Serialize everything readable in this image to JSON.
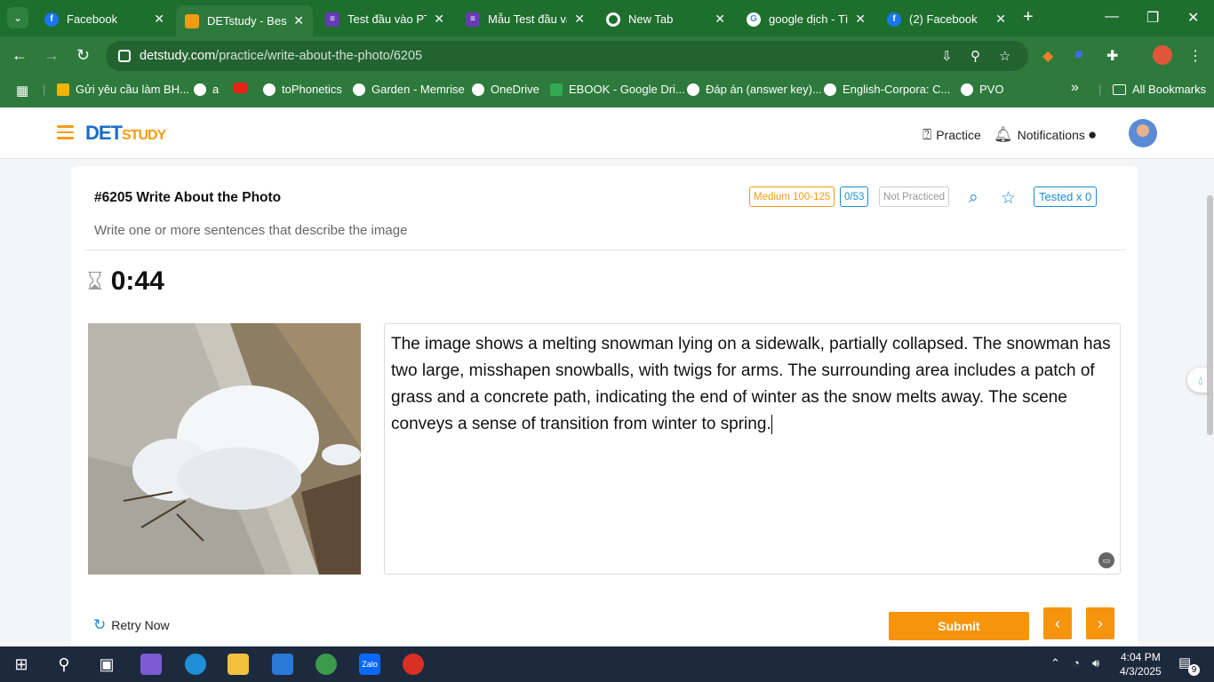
{
  "browser": {
    "tabs": [
      {
        "title": "Facebook",
        "favicon": "facebook-icon",
        "color": "#1877f2"
      },
      {
        "title": "DETstudy - Best",
        "favicon": "detstudy-icon",
        "color": "#f39c12"
      },
      {
        "title": "Test đầu vào PTE",
        "favicon": "forms-icon",
        "color": "#673ab7"
      },
      {
        "title": "Mẫu Test đầu vào",
        "favicon": "forms-icon",
        "color": "#673ab7"
      },
      {
        "title": "New Tab",
        "favicon": "chrome-icon",
        "color": "#ffffff"
      },
      {
        "title": "google dịch - Tìm",
        "favicon": "google-icon",
        "color": "#ffffff"
      },
      {
        "title": "(2) Facebook",
        "favicon": "facebook-icon",
        "color": "#1877f2"
      }
    ],
    "url_host": "detstudy.com",
    "url_path": "/practice/write-about-the-photo/6205",
    "bookmarks": [
      {
        "label": "Gửi yêu cầu làm BH..."
      },
      {
        "label": "a"
      },
      {
        "label": ""
      },
      {
        "label": "toPhonetics"
      },
      {
        "label": "Garden - Memrise"
      },
      {
        "label": "OneDrive"
      },
      {
        "label": "EBOOK - Google Dri..."
      },
      {
        "label": "Đáp án (answer key)..."
      },
      {
        "label": "English-Corpora: C..."
      },
      {
        "label": "PVO"
      }
    ],
    "bookmarks_more": "»",
    "all_bookmarks": "All Bookmarks"
  },
  "header": {
    "logo_main": "DET",
    "logo_sub": "STUDY",
    "practice": "Practice",
    "notifications": "Notifications"
  },
  "question": {
    "title": "#6205 Write About the Photo",
    "level": "Medium 100-125",
    "progress": "0/53",
    "status": "Not Practiced",
    "tested": "Tested x 0",
    "instruction": "Write one or more sentences that describe the image"
  },
  "timer": "0:44",
  "answer_text": " The image shows a melting snowman lying on a sidewalk, partially collapsed. The snowman has two large, misshapen snowballs, with twigs for arms. The surrounding area includes a patch of grass and a concrete path, indicating the end of winter as the snow melts away. The scene conveys a sense of transition from winter to spring.",
  "actions": {
    "retry": "Retry Now",
    "submit": "Submit",
    "prev": "‹",
    "next": "›"
  },
  "taskbar": {
    "time": "4:04 PM",
    "date": "4/3/2025",
    "notif_count": "9"
  },
  "colors": {
    "brand_orange": "#f7940e",
    "brand_blue": "#1b6cc8",
    "chrome_green": "#2d7a3c"
  }
}
